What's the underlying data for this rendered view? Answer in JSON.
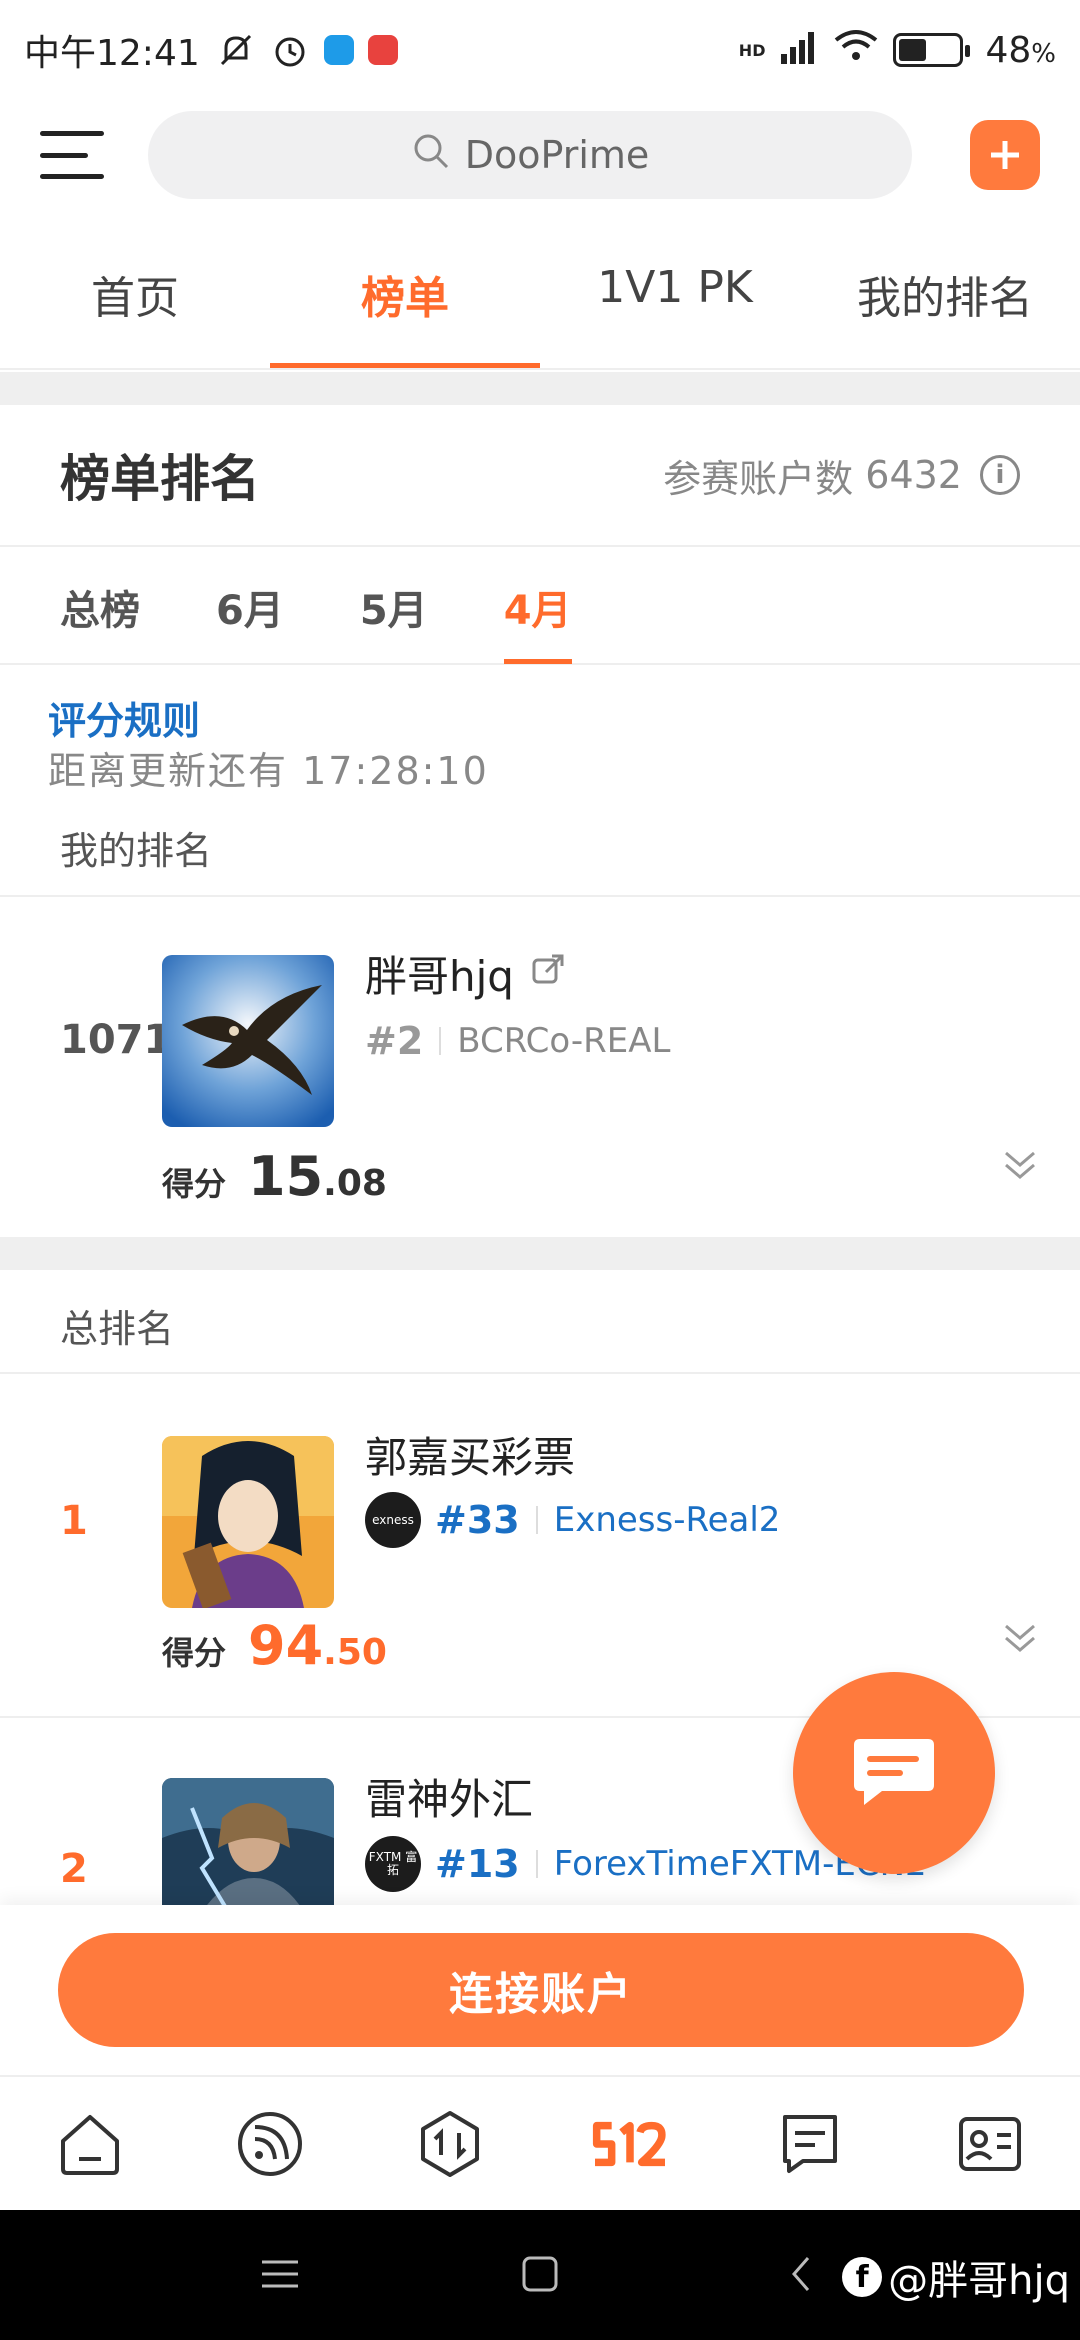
{
  "status_bar": {
    "time": "中午12:41",
    "battery": "48",
    "battery_unit": "%",
    "network": "HD"
  },
  "header": {
    "search_placeholder": "DooPrime"
  },
  "tabs": [
    {
      "label": "首页"
    },
    {
      "label": "榜单"
    },
    {
      "label": "1V1 PK"
    },
    {
      "label": "我的排名"
    }
  ],
  "ranking": {
    "title": "榜单排名",
    "participants_label": "参赛账户数",
    "participants_count": "6432",
    "month_tabs": [
      "总榜",
      "6月",
      "5月",
      "4月"
    ],
    "rules_link": "评分规则",
    "countdown_label": "距离更新还有",
    "countdown": "17:28:10",
    "my_rank_label": "我的排名",
    "total_rank_label": "总排名"
  },
  "my_entry": {
    "rank": "1071",
    "name": "胖哥hjq",
    "sub_rank": "#2",
    "account": "BCRCo-REAL",
    "score_label": "得分",
    "score_int": "15",
    "score_dec": ".08"
  },
  "entries": [
    {
      "rank": "1",
      "name": "郭嘉买彩票",
      "broker_logo_text": "exness",
      "sub_rank": "#33",
      "account": "Exness-Real2",
      "score_label": "得分",
      "score_int": "94",
      "score_dec": ".50"
    },
    {
      "rank": "2",
      "name": "雷神外汇",
      "broker_logo_text": "FXTM 富拓",
      "sub_rank": "#13",
      "account": "ForexTimeFXTM-ECN2"
    }
  ],
  "connect_button": "连接账户",
  "watermark": "@胖哥hjq",
  "colors": {
    "accent": "#ff6b2c",
    "link": "#1a6fc4",
    "muted": "#888888"
  }
}
